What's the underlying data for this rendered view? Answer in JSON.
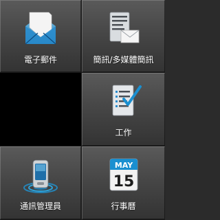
{
  "tiles": [
    {
      "label": "電子郵件",
      "icon": "email-envelope-icon"
    },
    {
      "label": "簡訊/多媒體簡訊",
      "icon": "sms-mms-icon"
    },
    {
      "label": "",
      "icon": ""
    },
    {
      "label": "工作",
      "icon": "tasks-checklist-icon"
    },
    {
      "label": "通訊管理員",
      "icon": "comm-manager-phone-icon"
    },
    {
      "label": "行事曆",
      "icon": "calendar-icon"
    }
  ],
  "calendar": {
    "month": "MAY",
    "day": "15"
  },
  "colors": {
    "accent": "#1a8fd0",
    "tile_top": "#5a5a5a",
    "tile_bottom": "#333333"
  }
}
